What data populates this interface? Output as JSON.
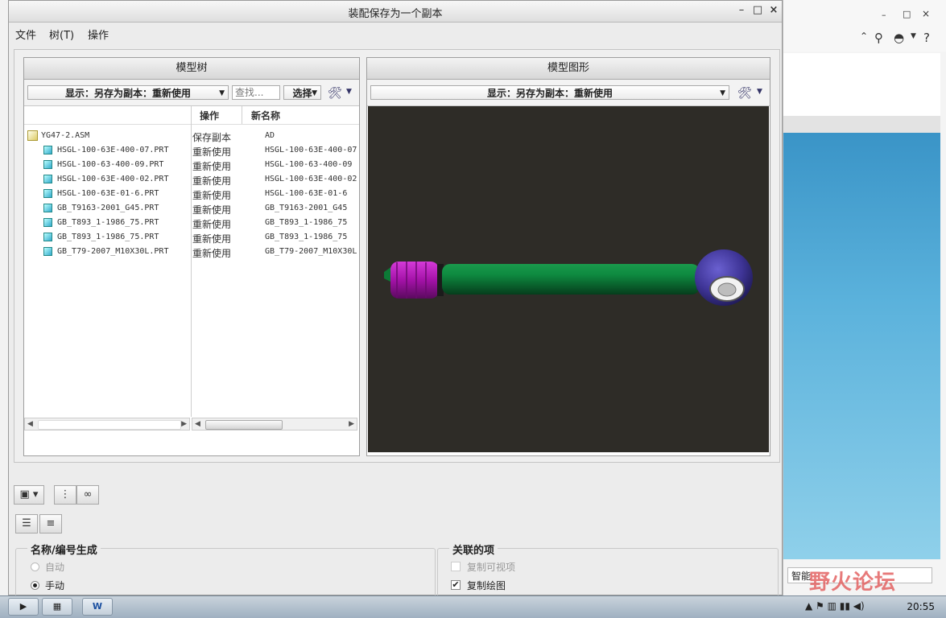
{
  "dialog": {
    "title": "装配保存为一个副本",
    "controls": {
      "minimize": "–",
      "maximize": "□",
      "close": "×"
    }
  },
  "menu": [
    "文件",
    "树(T)",
    "操作"
  ],
  "model_tree": {
    "header": "模型树",
    "display_combo": "显示：另存为副本：重新使用",
    "search_placeholder": "查找...",
    "select_label": "选择",
    "columns": {
      "op": "操作",
      "new_name": "新名称"
    },
    "rows": [
      {
        "name": "YG47-2.ASM",
        "op": "保存副本",
        "new_name": "AD",
        "type": "asm"
      },
      {
        "name": "HSGL-100-63E-400-07.PRT",
        "op": "重新使用",
        "new_name": "HSGL-100-63E-400-07",
        "type": "prt"
      },
      {
        "name": "HSGL-100-63-400-09.PRT",
        "op": "重新使用",
        "new_name": "HSGL-100-63-400-09",
        "type": "prt"
      },
      {
        "name": "HSGL-100-63E-400-02.PRT",
        "op": "重新使用",
        "new_name": "HSGL-100-63E-400-02",
        "type": "prt"
      },
      {
        "name": "HSGL-100-63E-01-6.PRT",
        "op": "重新使用",
        "new_name": "HSGL-100-63E-01-6",
        "type": "prt"
      },
      {
        "name": "GB_T9163-2001_G45.PRT",
        "op": "重新使用",
        "new_name": "GB_T9163-2001_G45",
        "type": "prt"
      },
      {
        "name": "GB_T893_1-1986_75.PRT",
        "op": "重新使用",
        "new_name": "GB_T893_1-1986_75",
        "type": "prt"
      },
      {
        "name": "GB_T893_1-1986_75.PRT",
        "op": "重新使用",
        "new_name": "GB_T893_1-1986_75",
        "type": "prt"
      },
      {
        "name": "GB_T79-2007_M10X30L.PRT",
        "op": "重新使用",
        "new_name": "GB_T79-2007_M10X30L",
        "type": "prt"
      }
    ]
  },
  "model_graphics": {
    "header": "模型图形",
    "display_combo": "显示：另存为副本：重新使用",
    "background_color": "#2e2c27",
    "rod_color": "#0f7a3a",
    "nut_color": "#b316b8",
    "eye_color": "#4a3ea8"
  },
  "name_generation": {
    "title": "名称/编号生成",
    "options": [
      {
        "label": "自动",
        "selected": false,
        "enabled": false
      },
      {
        "label": "手动",
        "selected": true,
        "enabled": true
      }
    ]
  },
  "related_items": {
    "title": "关联的项",
    "options": [
      {
        "label": "复制可视项",
        "checked": false,
        "enabled": false
      },
      {
        "label": "复制绘图",
        "checked": true,
        "enabled": true
      }
    ]
  },
  "background_app": {
    "dropdown_value": "智能"
  },
  "watermark": "野火论坛",
  "taskbar": {
    "time": "20:55"
  }
}
